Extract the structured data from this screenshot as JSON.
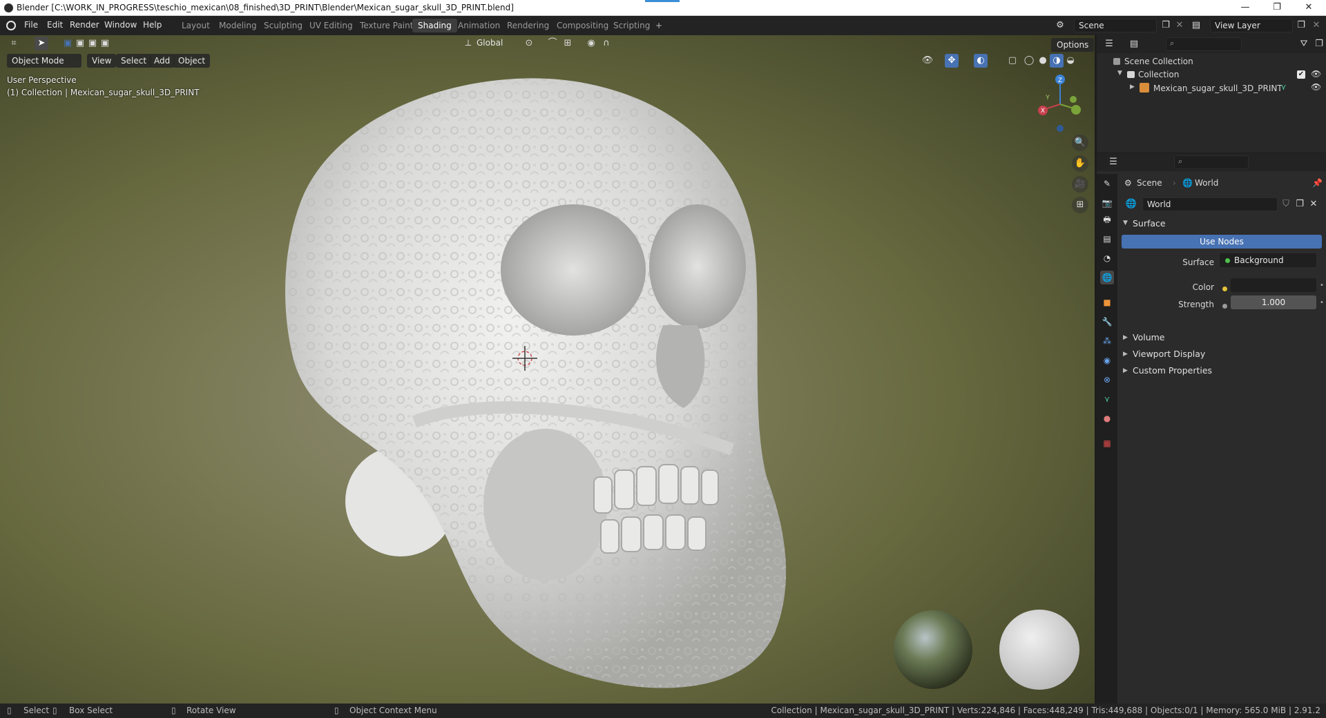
{
  "window": {
    "title": "Blender [C:\\WORK_IN_PROGRESS\\teschio_mexican\\08_finished\\3D_PRINT\\Blender\\Mexican_sugar_skull_3D_PRINT.blend]",
    "minimize": "—",
    "restore": "❐",
    "close": "✕"
  },
  "menu": [
    "File",
    "Edit",
    "Render",
    "Window",
    "Help"
  ],
  "workspaces": [
    "Layout",
    "Modeling",
    "Sculpting",
    "UV Editing",
    "Texture Paint",
    "Shading",
    "Animation",
    "Rendering",
    "Compositing",
    "Scripting"
  ],
  "active_workspace": "Shading",
  "add_workspace": "+",
  "scene_name": "Scene",
  "view_layer": "View Layer",
  "viewport": {
    "mode": "Object Mode",
    "menus": [
      "View",
      "Select",
      "Add",
      "Object"
    ],
    "transform_orientation": "Global",
    "options_label": "Options",
    "perspective_label": "User Perspective",
    "collection_label": "(1) Collection | Mexican_sugar_skull_3D_PRINT",
    "gizmo": {
      "x": "X",
      "y": "Y",
      "z": "Z"
    }
  },
  "outliner": {
    "root": "Scene Collection",
    "collection": "Collection",
    "object": "Mexican_sugar_skull_3D_PRINT"
  },
  "properties": {
    "breadcrumb_scene": "Scene",
    "breadcrumb_world": "World",
    "world_name": "World",
    "surface_panel": "Surface",
    "use_nodes": "Use Nodes",
    "surface_label": "Surface",
    "surface_value": "Background",
    "color_label": "Color",
    "strength_label": "Strength",
    "strength_value": "1.000",
    "collapsed_panels": [
      "Volume",
      "Viewport Display",
      "Custom Properties"
    ]
  },
  "statusbar": {
    "select": "Select",
    "box_select": "Box Select",
    "rotate_view": "Rotate View",
    "context_menu": "Object Context Menu",
    "stats": "Collection | Mexican_sugar_skull_3D_PRINT | Verts:224,846 | Faces:448,249 | Tris:449,688 | Objects:0/1 | Memory: 565.0 MiB | 2.91.2"
  },
  "colors": {
    "accent_blue": "#4772b3",
    "active_tab": "#3d3d3d",
    "panel_bg": "#2b2b2b",
    "color_swatch": "#1f1f1f"
  }
}
